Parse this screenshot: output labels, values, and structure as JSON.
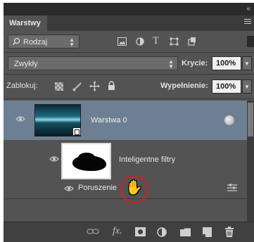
{
  "panel": {
    "tab_label": "Warstwy",
    "collapse_glyph": "«",
    "menu_icon": "panel-menu-icon"
  },
  "filter_row": {
    "kind_select": "Rodzaj",
    "kind_icon": "search-icon",
    "filter_icons": [
      "image-filter-icon",
      "adjustment-filter-icon",
      "type-filter-icon",
      "shape-filter-icon",
      "smart-object-filter-icon"
    ],
    "type_glyph": "T"
  },
  "blend_row": {
    "blend_mode": "Zwykły",
    "opacity_label": "Krycie:",
    "opacity_value": "100%"
  },
  "lock_row": {
    "lock_label": "Zablokuj:",
    "lock_icons": [
      "lock-transparent-icon",
      "lock-image-icon",
      "lock-position-icon",
      "lock-all-icon"
    ],
    "fill_label": "Wypełnienie:",
    "fill_value": "100%"
  },
  "layers": [
    {
      "name": "Warstwa 0",
      "selected": true,
      "visible": true,
      "smart_object": true,
      "filters_label": "Inteligentne filtry",
      "filters": [
        {
          "name": "Poruszenie",
          "visible": true
        }
      ]
    }
  ],
  "bottom_bar": {
    "fx_label": "fx.",
    "icons": [
      "link-layers-icon",
      "fx-icon",
      "add-mask-icon",
      "adjustment-layer-icon",
      "new-group-icon",
      "new-layer-icon",
      "trash-icon"
    ]
  },
  "colors": {
    "panel_bg": "#535353",
    "selected_layer": "#6d7f92",
    "highlight_circle": "#d71c24"
  }
}
